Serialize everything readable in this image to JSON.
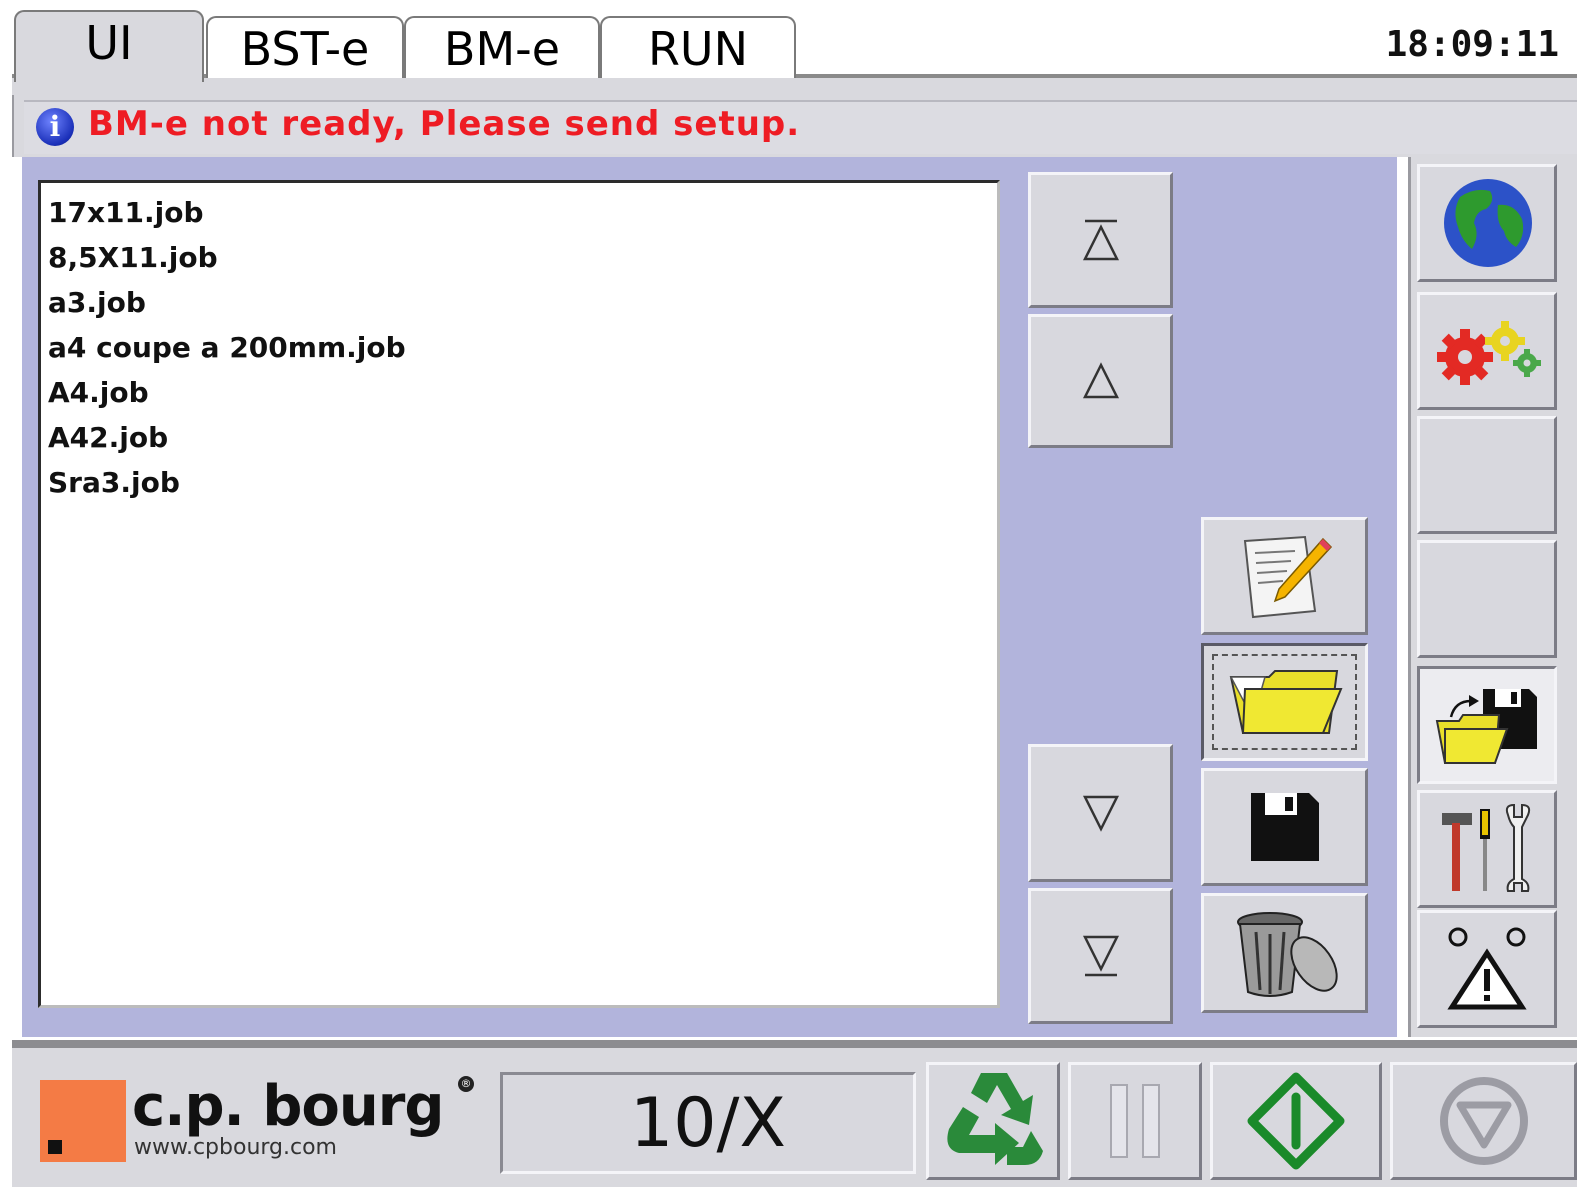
{
  "tabs": [
    {
      "label": "UI",
      "active": true
    },
    {
      "label": "BST-e",
      "active": false
    },
    {
      "label": "BM-e",
      "active": false
    },
    {
      "label": "RUN",
      "active": false
    }
  ],
  "clock": "18:09:11",
  "message": {
    "icon": "info-icon",
    "text": "BM-e not ready, Please send setup.",
    "color": "#ee1c24"
  },
  "job_list": [
    "17x11.job",
    "8,5X11.job",
    "a3.job",
    "a4 coupe a 200mm.job",
    "A4.job",
    "A42.job",
    "Sra3.job"
  ],
  "nav_buttons": [
    "scroll-top-icon",
    "scroll-up-icon",
    "scroll-down-icon",
    "scroll-bottom-icon"
  ],
  "file_actions": [
    "edit-icon",
    "open-folder-icon",
    "save-disk-icon",
    "trash-icon"
  ],
  "sidebar_icons": [
    "globe-icon",
    "gears-icon",
    "blank",
    "blank",
    "load-save-icon",
    "tools-icon",
    "warning-icon"
  ],
  "footer": {
    "logo_text": "c.p. bourg",
    "logo_url": "www.cpbourg.com",
    "logo_reg": "®",
    "counter": "10/X",
    "buttons": [
      "recycle-icon",
      "pause-icon",
      "start-icon",
      "stop-icon"
    ]
  },
  "colors": {
    "panel": "#b2b4dc",
    "chrome": "#d9d9de",
    "logo_orange": "#f47b45",
    "start_green": "#1a8a2a",
    "recycle_green": "#2a8a3a"
  }
}
